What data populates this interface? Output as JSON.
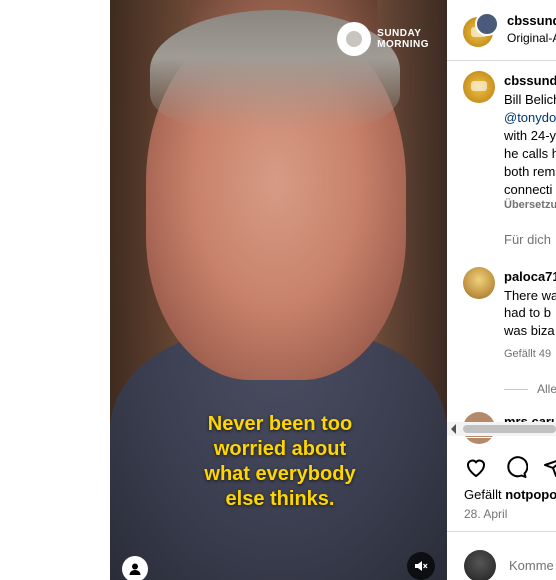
{
  "video": {
    "brand_line1": "SUNDAY",
    "brand_line2": "MORNING",
    "caption_lines": [
      "Never been too",
      "worried about",
      "what everybody",
      "else thinks."
    ]
  },
  "header": {
    "username": "cbssund",
    "subtitle": "Original-A"
  },
  "post": {
    "username": "cbssund",
    "text_lines": [
      "Bill Belich",
      "@tonydo",
      "with 24-y",
      "he calls h",
      "both rem",
      "connecti"
    ],
    "translate": "Übersetzu"
  },
  "for_you": "Für dich",
  "comment": {
    "username": "paloca71",
    "text_lines": [
      "There wa",
      "had to b",
      "was biza"
    ],
    "likes": "Gefällt 49"
  },
  "view_all": "Alle",
  "next_comment_user": "mrs.caru",
  "likes_line": {
    "prefix": "Gefällt",
    "user": "notpopo"
  },
  "date": "28. April",
  "comment_placeholder": "Komme",
  "colors": {
    "caption": "#ffd600",
    "link": "#00376b",
    "muted": "#737373"
  }
}
